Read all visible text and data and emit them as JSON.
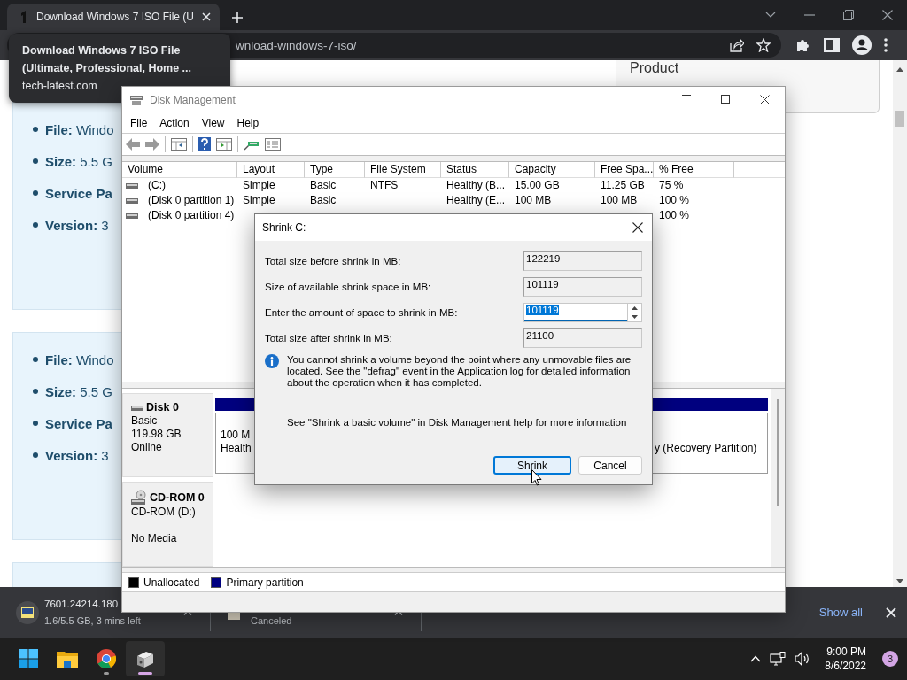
{
  "browser": {
    "tabs": [
      {
        "title": "Download Windows 7 ISO File (U",
        "selected": true
      }
    ],
    "address": "wnload-windows-7-iso/",
    "tooltip": {
      "title": "Download Windows 7 ISO File (Ultimate, Professional, Home ...",
      "domain": "tech-latest.com"
    }
  },
  "page": {
    "cards": [
      {
        "kind": "card",
        "specs": [
          {
            "label": "File:",
            "value": "Windo"
          },
          {
            "label": "Size:",
            "value": "5.5 G"
          },
          {
            "label": "Service Pa"
          },
          {
            "label": "Version:",
            "value": "3"
          }
        ]
      },
      {
        "kind": "card",
        "specs": [
          {
            "label": "File:",
            "value": "Windo"
          },
          {
            "label": "Size:",
            "value": "5.5 G"
          },
          {
            "label": "Service Pa"
          },
          {
            "label": "Version:",
            "value": "3"
          }
        ]
      },
      {
        "kind": "card"
      }
    ],
    "product_card": {
      "title": "Product"
    }
  },
  "disk_management": {
    "title": "Disk Management",
    "menu": [
      "File",
      "Action",
      "View",
      "Help"
    ],
    "columns": [
      "Volume",
      "Layout",
      "Type",
      "File System",
      "Status",
      "Capacity",
      "Free Spa...",
      "% Free"
    ],
    "volumes": [
      {
        "volume": "(C:)",
        "layout": "Simple",
        "type": "Basic",
        "file_system": "NTFS",
        "status": "Healthy (B...",
        "capacity": "15.00 GB",
        "free_space": "11.25 GB",
        "percent_free": "75 %"
      },
      {
        "volume": "(Disk 0 partition 1)",
        "layout": "Simple",
        "type": "Basic",
        "status": "Healthy (E...",
        "capacity": "100 MB",
        "free_space": "100 MB",
        "percent_free": "100 %"
      },
      {
        "volume": "(Disk 0 partition 4)",
        "percent_free": "100 %"
      }
    ],
    "disks": [
      {
        "kind": "disk",
        "name": "Disk 0",
        "details": [
          "Basic",
          "119.98 GB",
          "Online"
        ],
        "partitions": [
          {
            "lines": [
              "100 M",
              "Health"
            ]
          },
          {
            "lines": [
              "y (Recovery Partition)"
            ]
          }
        ]
      },
      {
        "kind": "cdrom",
        "name": "CD-ROM 0",
        "details": [
          "CD-ROM (D:)"
        ],
        "media": "No Media"
      }
    ],
    "legend": [
      {
        "label": "Unallocated",
        "color": "#000000"
      },
      {
        "label": "Primary partition",
        "color": "#000080"
      }
    ]
  },
  "dialog": {
    "title": "Shrink C:",
    "fields": [
      {
        "kind": "readonly",
        "label": "Total size before shrink in MB:",
        "value": "122219"
      },
      {
        "kind": "readonly",
        "label": "Size of available shrink space in MB:",
        "value": "101119"
      },
      {
        "kind": "spin",
        "label": "Enter the amount of space to shrink in MB:",
        "value": "101119"
      },
      {
        "kind": "readonly",
        "label": "Total size after shrink in MB:",
        "value": "21100"
      }
    ],
    "info": "You cannot shrink a volume beyond the point where any unmovable files are located. See the \"defrag\" event in the Application log for detailed information about the operation when it has completed.",
    "help": "See \"Shrink a basic volume\" in Disk Management help for more information",
    "buttons": [
      {
        "label": "Shrink",
        "default": true
      },
      {
        "label": "Cancel",
        "default": false
      }
    ]
  },
  "downloads": {
    "items": [
      {
        "kind": "iso",
        "name": "7601.24214.180",
        "detail": "1.6/5.5 GB, 3 mins left"
      },
      {
        "kind": "file",
        "detail": "Canceled"
      }
    ],
    "show_all": "Show all"
  },
  "taskbar": {
    "apps": [
      {
        "kind": "start",
        "running": false,
        "active": false
      },
      {
        "kind": "explorer",
        "running": false,
        "active": false
      },
      {
        "kind": "chrome",
        "running": true,
        "active": false
      },
      {
        "kind": "diskmgmt",
        "running": true,
        "active": true
      }
    ],
    "time": "9:00 PM",
    "date": "8/6/2022",
    "notifications": "3"
  }
}
